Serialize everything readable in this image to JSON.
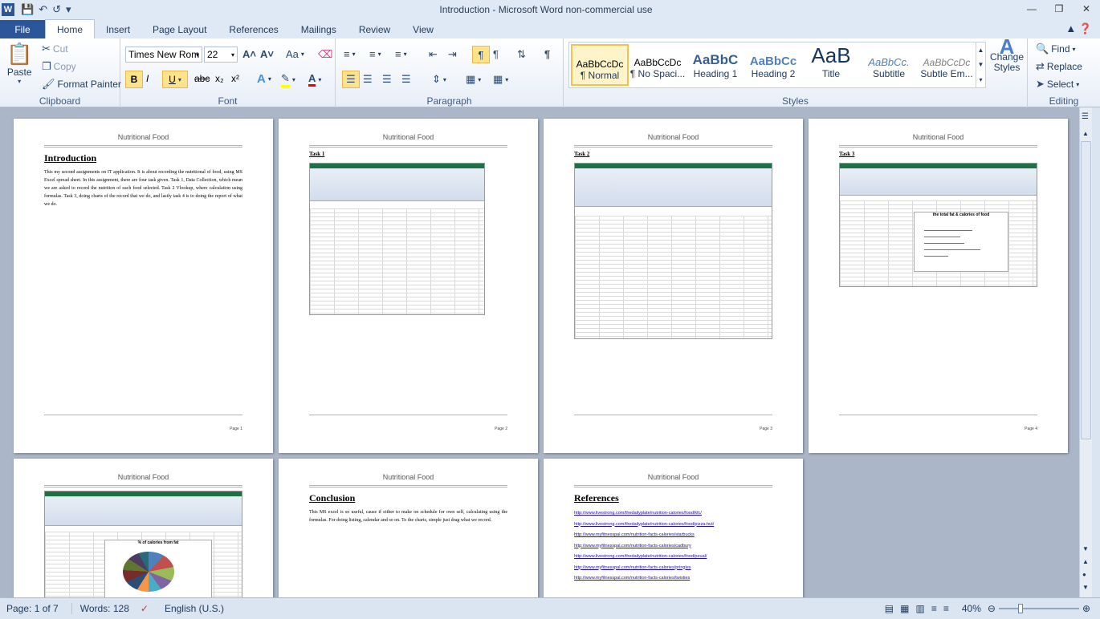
{
  "window": {
    "title": "Introduction  -  Microsoft Word non-commercial use",
    "controls": [
      "minimize-icon",
      "restore-icon",
      "close-icon"
    ]
  },
  "qat": {
    "icons": [
      "save-icon",
      "undo-icon",
      "redo-icon",
      "customize-icon"
    ]
  },
  "tabs": {
    "file": "File",
    "items": [
      "Home",
      "Insert",
      "Page Layout",
      "References",
      "Mailings",
      "Review",
      "View"
    ],
    "active": "Home"
  },
  "clipboard": {
    "paste": "Paste",
    "cut": "Cut",
    "copy": "Copy",
    "format_painter": "Format Painter",
    "label": "Clipboard"
  },
  "font": {
    "name": "Times New Rom",
    "size": "22",
    "label": "Font",
    "bold": "B",
    "italic": "I",
    "underline": "U",
    "strike": "abc",
    "sub": "x₂",
    "sup": "x²",
    "grow": "A˄",
    "shrink": "A˅",
    "case": "Aa",
    "clear": "A"
  },
  "paragraph": {
    "label": "Paragraph"
  },
  "styles": {
    "label": "Styles",
    "items": [
      {
        "preview": "AaBbCcDc",
        "name": "¶ Normal"
      },
      {
        "preview": "AaBbCcDc",
        "name": "¶ No Spaci..."
      },
      {
        "preview": "AaBbC",
        "name": "Heading 1"
      },
      {
        "preview": "AaBbCc",
        "name": "Heading 2"
      },
      {
        "preview": "AaB",
        "name": "Title"
      },
      {
        "preview": "AaBbCc.",
        "name": "Subtitle"
      },
      {
        "preview": "AaBbCcDc",
        "name": "Subtle Em..."
      }
    ],
    "change": "Change Styles"
  },
  "editing": {
    "find": "Find",
    "replace": "Replace",
    "select": "Select",
    "label": "Editing"
  },
  "pages": {
    "header": "Nutritional Food",
    "p1": {
      "title": "Introduction",
      "body": "This my second assignments on IT application. It is about recording the nutritional of food, using MS Excel spread sheet. In this assignment, there are four task given. Task 1, Data Collection, which mean we are asked to record the nutrition of each food selected. Task 2 Vlookup, where calculation using formulas. Task 3, doing charts of the record that we do, and lastly task 4 is to doing the report of what we do."
    },
    "p2": {
      "title": "Task 1"
    },
    "p3": {
      "title": "Task 2"
    },
    "p4": {
      "title": "Task 3",
      "chart_title": "the total fat & calories of food"
    },
    "p5": {
      "chart_title": "% of calories from fat"
    },
    "p6": {
      "title": "Conclusion",
      "body": "This MS excel is so useful, cause if either to make on schedule for own self, calculating using the formulas. For doing listing, calendar and so on. To the charts, simple just drag what we record."
    },
    "p7": {
      "title": "References",
      "links": [
        "http://www.livestrong.com/thedailyplate/nutrition-calories/food/kfc/",
        "http://www.livestrong.com/thedailyplate/nutrition-calories/food/pizza-hut/",
        "http://www.myfitnesspal.com/nutrition-facts-calories/starbucks",
        "http://www.myfitnesspal.com/nutrition-facts-calories/cadbury",
        "http://www.livestrong.com/thedailyplate/nutrition-calories/food/peual/",
        "http://www.myfitnesspal.com/nutrition-facts-calories/pringles",
        "http://www.myfitnesspal.com/nutrition-facts-calories/twisties"
      ]
    },
    "page_numbers": [
      "Page 1",
      "Page 2",
      "Page 3",
      "Page 4"
    ]
  },
  "status": {
    "page": "Page: 1 of 7",
    "words": "Words: 128",
    "language": "English (U.S.)",
    "zoom": "40%"
  }
}
